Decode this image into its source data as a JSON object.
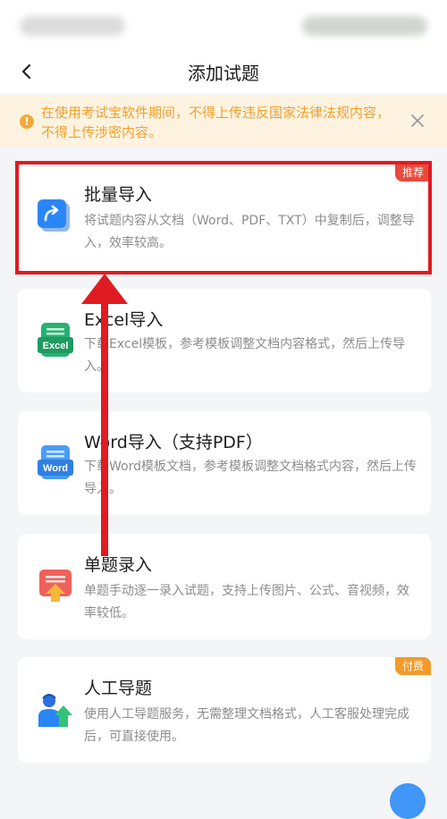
{
  "nav": {
    "title": "添加试题",
    "back_icon": "chevron-left-icon"
  },
  "notice": {
    "text": "在使用考试宝软件期间，不得上传违反国家法律法规内容，不得上传涉密内容。",
    "icon": "warning-icon",
    "close_icon": "close-icon",
    "color": "#f0a031",
    "background": "#fdf3e0"
  },
  "cards": [
    {
      "title": "批量导入",
      "desc": "将试题内容从文档（Word、PDF、TXT）中复制后，调整导入，效率较高。",
      "tag": "推荐",
      "tag_color": "#e84a3c",
      "icon": "batch-import-icon"
    },
    {
      "title": "Excel导入",
      "desc": "下载Excel模板，参考模板调整文档内容格式，然后上传导入。",
      "icon": "excel-icon",
      "icon_label": "Excel"
    },
    {
      "title": "Word导入（支持PDF）",
      "desc": "下载Word模板文档，参考模板调整文档格式内容，然后上传导入。",
      "icon": "word-icon",
      "icon_label": "Word"
    },
    {
      "title": "单题录入",
      "desc": "单题手动逐一录入试题，支持上传图片、公式、音视频，效率较低。",
      "icon": "single-entry-icon"
    },
    {
      "title": "人工导题",
      "desc": "使用人工导题服务，无需整理文档格式，人工客服处理完成后，可直接使用。",
      "tag": "付费",
      "tag_color": "#f39a2b",
      "icon": "manual-import-icon"
    }
  ],
  "annotation": {
    "highlight_color": "#e01b22"
  }
}
